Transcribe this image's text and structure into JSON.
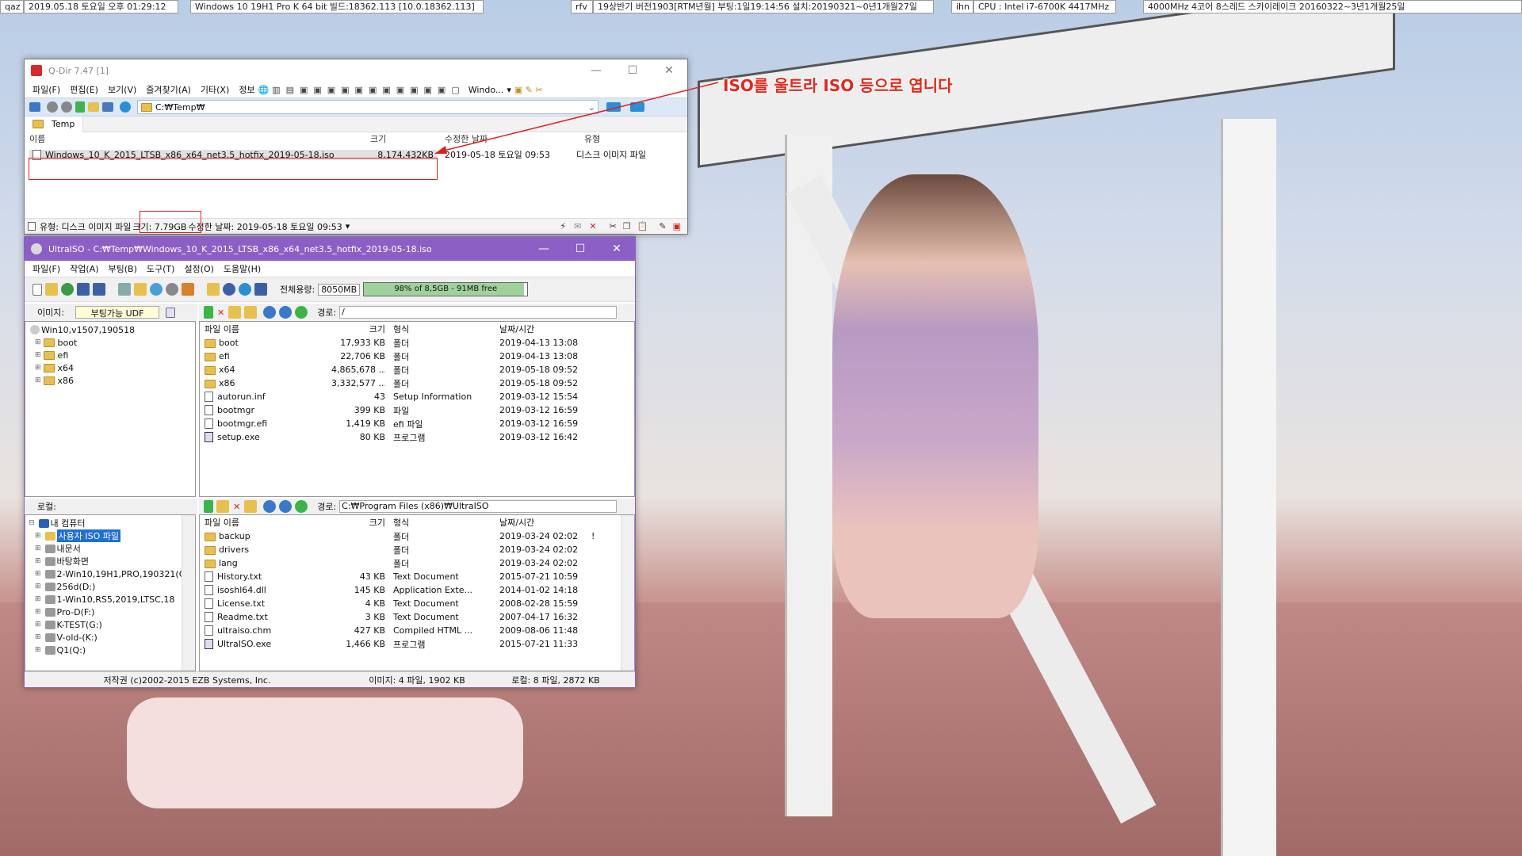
{
  "topbar": {
    "t1": "qaz",
    "t2": "2019.05.18 토요일 오후 01:29:12",
    "t3": "Windows 10 19H1 Pro K 64 bit 빌드:18362.113 [10.0.18362.113]",
    "t4": "rfv",
    "t5": "19상반기 버전1903[RTM년월] 부팅:1일19:14:56 설치:20190321~0년1개월27일",
    "t6": "ihn",
    "t7": "CPU : Intel i7-6700K 4417MHz",
    "t8": "4000MHz 4코어 8스레드 스카이레이크 20160322~3년1개월25일"
  },
  "annotation": "ISO를 울트라 ISO 등으로 엽니다",
  "qdir": {
    "title": "Q-Dir 7.47 [1]",
    "menu": [
      "파일(F)",
      "편집(E)",
      "보기(V)",
      "즐겨찾기(A)",
      "기타(X)",
      "정보"
    ],
    "toolbar_window": "Windo...",
    "path": "C:₩Temp₩",
    "tab": "Temp",
    "headers": {
      "name": "이름",
      "size": "크기",
      "date": "수정한 날짜",
      "type": "유형"
    },
    "file": {
      "name": "Windows_10_K_2015_LTSB_x86_x64_net3.5_hotfix_2019-05-18.iso",
      "size": "8,174,432KB",
      "date": "2019-05-18 토요일 09:53",
      "type": "디스크 이미지 파일"
    },
    "status": {
      "type": "유형: 디스크 이미지 파일",
      "size": "크기: 7.79GB",
      "date": "수정한 날짜: 2019-05-18 토요일 09:53"
    }
  },
  "ultra": {
    "title": "UltraISO - C:₩Temp₩Windows_10_K_2015_LTSB_x86_x64_net3.5_hotfix_2019-05-18.iso",
    "menu": [
      "파일(F)",
      "작업(A)",
      "부팅(B)",
      "도구(T)",
      "설정(O)",
      "도움말(H)"
    ],
    "capacity_label": "전체용량:",
    "capacity_value": "8050MB",
    "capacity_bar": "98% of 8,5GB - 91MB free",
    "capacity_fill": 0.98,
    "image_label": "이미지:",
    "image_type": "부팅가능 UDF",
    "path_label": "경로:",
    "iso_path": "/",
    "local_label": "로컬:",
    "local_path": "C:₩Program Files (x86)₩UltraISO",
    "tree_root": "Win10,v1507,190518",
    "tree": [
      "boot",
      "efi",
      "x64",
      "x86"
    ],
    "cols": {
      "name": "파일 이름",
      "size": "크기",
      "type": "형식",
      "date": "날짜/시간"
    },
    "iso_files": [
      {
        "name": "boot",
        "size": "17,933 KB",
        "type": "폴더",
        "date": "2019-04-13 13:08",
        "kind": "folder"
      },
      {
        "name": "efi",
        "size": "22,706 KB",
        "type": "폴더",
        "date": "2019-04-13 13:08",
        "kind": "folder"
      },
      {
        "name": "x64",
        "size": "4,865,678 ...",
        "type": "폴더",
        "date": "2019-05-18 09:52",
        "kind": "folder"
      },
      {
        "name": "x86",
        "size": "3,332,577 ...",
        "type": "폴더",
        "date": "2019-05-18 09:52",
        "kind": "folder"
      },
      {
        "name": "autorun.inf",
        "size": "43",
        "type": "Setup Information",
        "date": "2019-03-12 15:54",
        "kind": "file"
      },
      {
        "name": "bootmgr",
        "size": "399 KB",
        "type": "파일",
        "date": "2019-03-12 16:59",
        "kind": "file"
      },
      {
        "name": "bootmgr.efi",
        "size": "1,419 KB",
        "type": "efi 파일",
        "date": "2019-03-12 16:59",
        "kind": "file"
      },
      {
        "name": "setup.exe",
        "size": "80 KB",
        "type": "프로그램",
        "date": "2019-03-12 16:42",
        "kind": "exe"
      }
    ],
    "local_tree": [
      "내 컴퓨터",
      "사용자 ISO 파일",
      "내문서",
      "바탕화면",
      "2-Win10,19H1,PRO,190321(C",
      "256d(D:)",
      "1-Win10,RS5,2019,LTSC,18",
      "Pro-D(F:)",
      "K-TEST(G:)",
      "V-old-(K:)",
      "Q1(Q:)"
    ],
    "local_files": [
      {
        "name": "backup",
        "size": "",
        "type": "폴더",
        "date": "2019-03-24 02:02",
        "kind": "folder",
        "mark": "!"
      },
      {
        "name": "drivers",
        "size": "",
        "type": "폴더",
        "date": "2019-03-24 02:02",
        "kind": "folder",
        "mark": ""
      },
      {
        "name": "lang",
        "size": "",
        "type": "폴더",
        "date": "2019-03-24 02:02",
        "kind": "folder",
        "mark": ""
      },
      {
        "name": "History.txt",
        "size": "43 KB",
        "type": "Text Document",
        "date": "2015-07-21 10:59",
        "kind": "file",
        "mark": ""
      },
      {
        "name": "isoshl64.dll",
        "size": "145 KB",
        "type": "Application Exte...",
        "date": "2014-01-02 14:18",
        "kind": "file",
        "mark": ""
      },
      {
        "name": "License.txt",
        "size": "4 KB",
        "type": "Text Document",
        "date": "2008-02-28 15:59",
        "kind": "file",
        "mark": ""
      },
      {
        "name": "Readme.txt",
        "size": "3 KB",
        "type": "Text Document",
        "date": "2007-04-17 16:32",
        "kind": "file",
        "mark": ""
      },
      {
        "name": "ultraiso.chm",
        "size": "427 KB",
        "type": "Compiled HTML ...",
        "date": "2009-08-06 11:48",
        "kind": "file",
        "mark": ""
      },
      {
        "name": "UltraISO.exe",
        "size": "1,466 KB",
        "type": "프로그램",
        "date": "2015-07-21 11:33",
        "kind": "exe",
        "mark": ""
      }
    ],
    "status": {
      "copyright": "저작권 (c)2002-2015 EZB Systems, Inc.",
      "image": "이미지: 4 파일, 1902 KB",
      "local": "로컬: 8 파일, 2872 KB"
    }
  }
}
